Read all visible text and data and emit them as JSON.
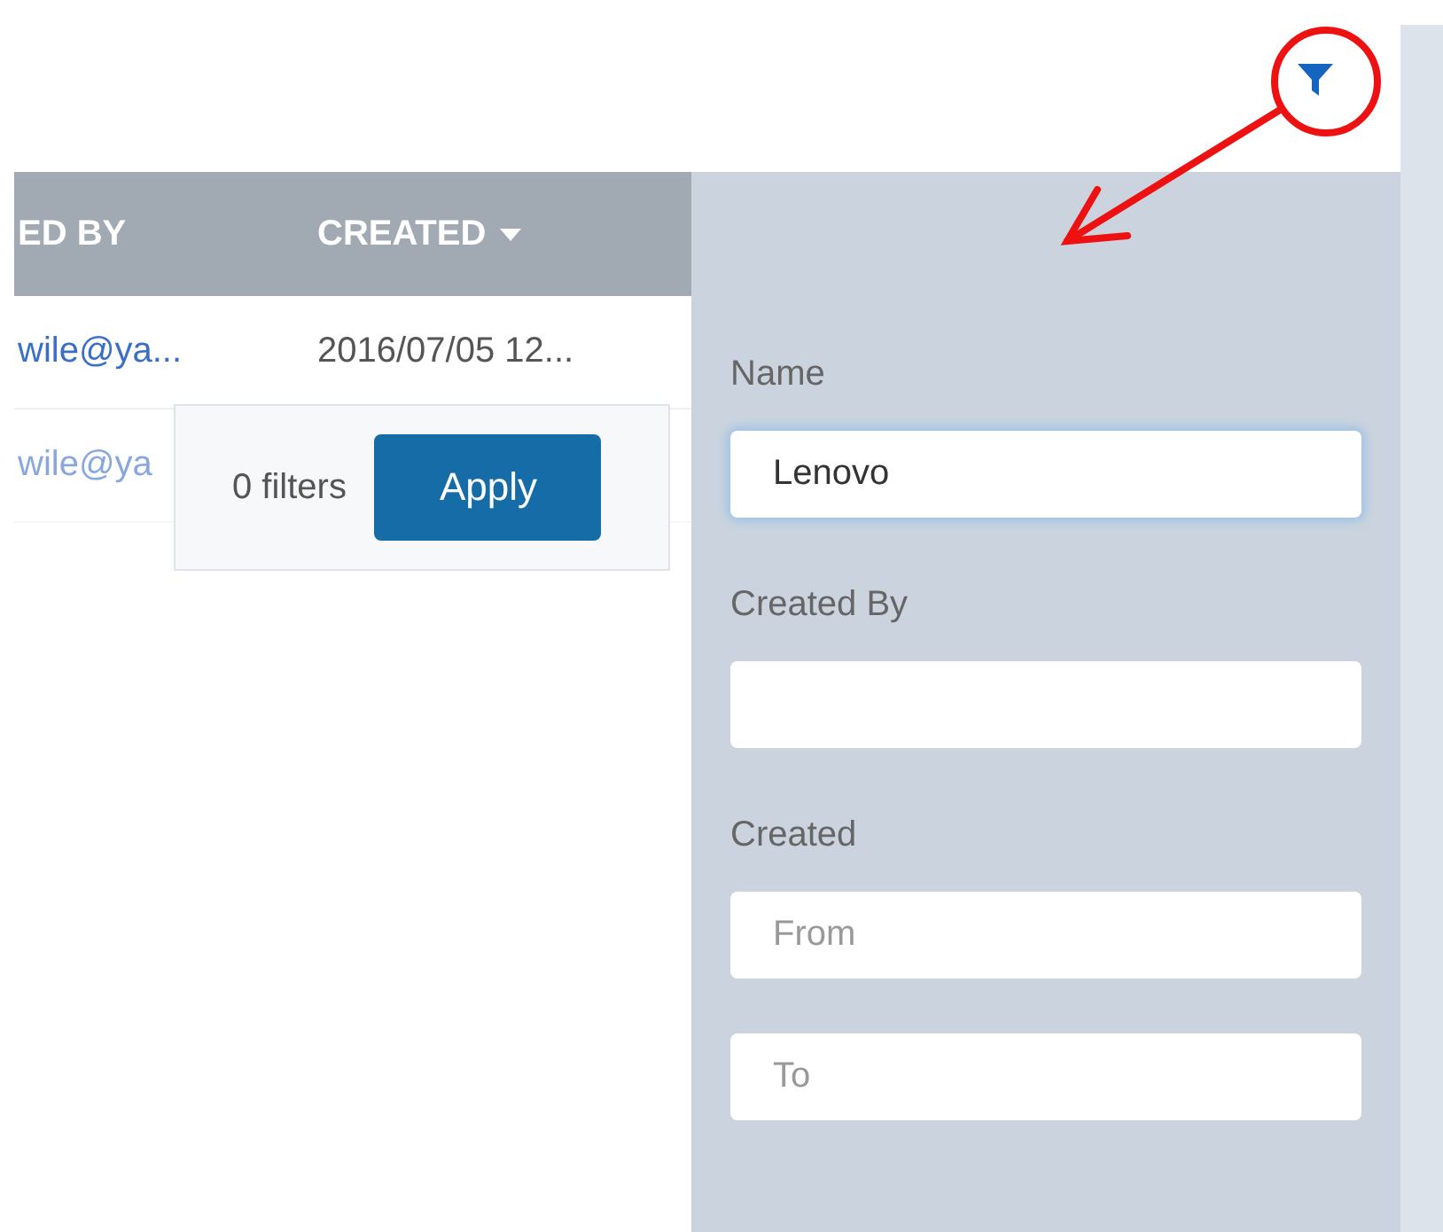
{
  "table": {
    "columns": [
      {
        "label": "ED BY",
        "sorted": false
      },
      {
        "label": "CREATED",
        "sorted": true
      }
    ],
    "rows": [
      {
        "cells": [
          "wile@ya...",
          "2016/07/05 12..."
        ]
      },
      {
        "cells": [
          "wile@ya"
        ]
      }
    ]
  },
  "apply_popup": {
    "count": "0 filters",
    "button": "Apply"
  },
  "filter_panel": {
    "fields": [
      {
        "label": "Name",
        "value": "Lenovo",
        "focused": true
      },
      {
        "label": "Created By",
        "focused": false
      },
      {
        "label": "Created",
        "placeholder": "From",
        "focused": false
      },
      {
        "placeholder": "To",
        "focused": false
      }
    ]
  }
}
